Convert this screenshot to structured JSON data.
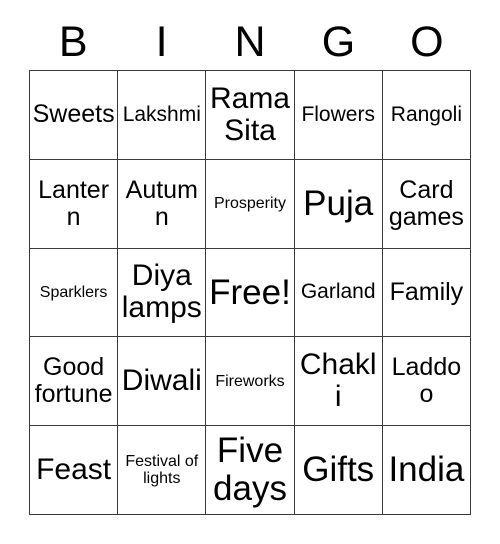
{
  "card": {
    "title_letters": [
      "B",
      "I",
      "N",
      "G",
      "O"
    ],
    "columns": 5,
    "rows": 5,
    "colors": {
      "background": "#ffffff",
      "grid_line": "#3a3a3a",
      "text": "#000000"
    },
    "cells": [
      {
        "label": "Sweets",
        "size": "md"
      },
      {
        "label": "Lakshmi",
        "size": "sm"
      },
      {
        "label": "Rama Sita",
        "size": "lg"
      },
      {
        "label": "Flowers",
        "size": "sm"
      },
      {
        "label": "Rangoli",
        "size": "sm"
      },
      {
        "label": "Lantern",
        "size": "md"
      },
      {
        "label": "Autumn",
        "size": "md"
      },
      {
        "label": "Prosperity",
        "size": "xs"
      },
      {
        "label": "Puja",
        "size": "xl"
      },
      {
        "label": "Card games",
        "size": "md"
      },
      {
        "label": "Sparklers",
        "size": "xs"
      },
      {
        "label": "Diya lamps",
        "size": "lg"
      },
      {
        "label": "Free!",
        "size": "xl"
      },
      {
        "label": "Garland",
        "size": "sm"
      },
      {
        "label": "Family",
        "size": "md"
      },
      {
        "label": "Good fortune",
        "size": "md"
      },
      {
        "label": "Diwali",
        "size": "lg"
      },
      {
        "label": "Fireworks",
        "size": "xs"
      },
      {
        "label": "Chakli",
        "size": "lg"
      },
      {
        "label": "Laddoo",
        "size": "md"
      },
      {
        "label": "Feast",
        "size": "lg"
      },
      {
        "label": "Festival of lights",
        "size": "xs"
      },
      {
        "label": "Five days",
        "size": "xl"
      },
      {
        "label": "Gifts",
        "size": "xl"
      },
      {
        "label": "India",
        "size": "xl"
      }
    ]
  }
}
